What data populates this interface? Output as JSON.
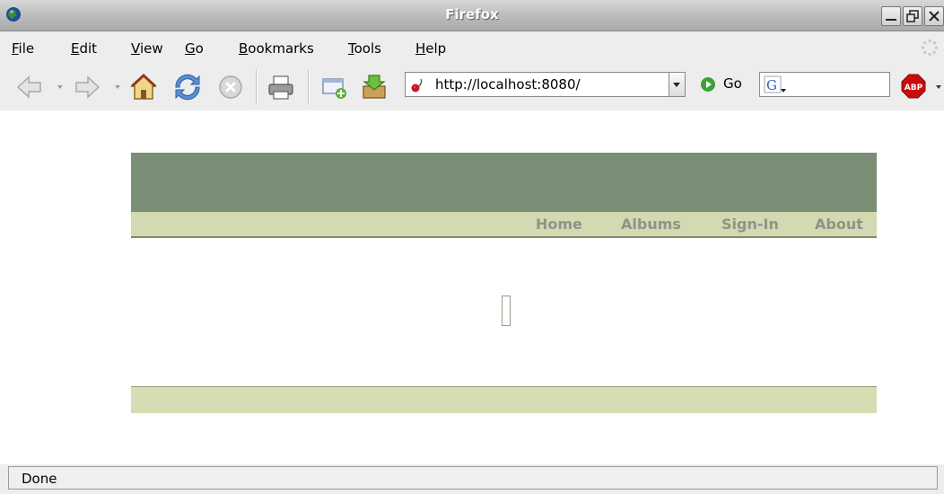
{
  "window": {
    "title": "Firefox"
  },
  "menubar": {
    "items": [
      {
        "label": "File",
        "mnemonic": "F"
      },
      {
        "label": "Edit",
        "mnemonic": "E"
      },
      {
        "label": "View",
        "mnemonic": "V"
      },
      {
        "label": "Go",
        "mnemonic": "G"
      },
      {
        "label": "Bookmarks",
        "mnemonic": "B"
      },
      {
        "label": "Tools",
        "mnemonic": "T"
      },
      {
        "label": "Help",
        "mnemonic": "H"
      }
    ]
  },
  "toolbar": {
    "url": "http://localhost:8080/",
    "go_label": "Go",
    "search_value": "",
    "icons": [
      "back-icon",
      "forward-icon",
      "home-icon",
      "reload-icon",
      "stop-icon",
      "print-icon",
      "new-bookmark-icon",
      "download-icon",
      "adblock-icon"
    ]
  },
  "page": {
    "nav": [
      "Home",
      "Albums",
      "Sign-In",
      "About"
    ],
    "colors": {
      "header": "#7b8f76",
      "nav_bar": "#d3d9b0",
      "nav_text": "#8e9487",
      "footer": "#d8dcb2"
    }
  },
  "statusbar": {
    "text": "Done"
  }
}
